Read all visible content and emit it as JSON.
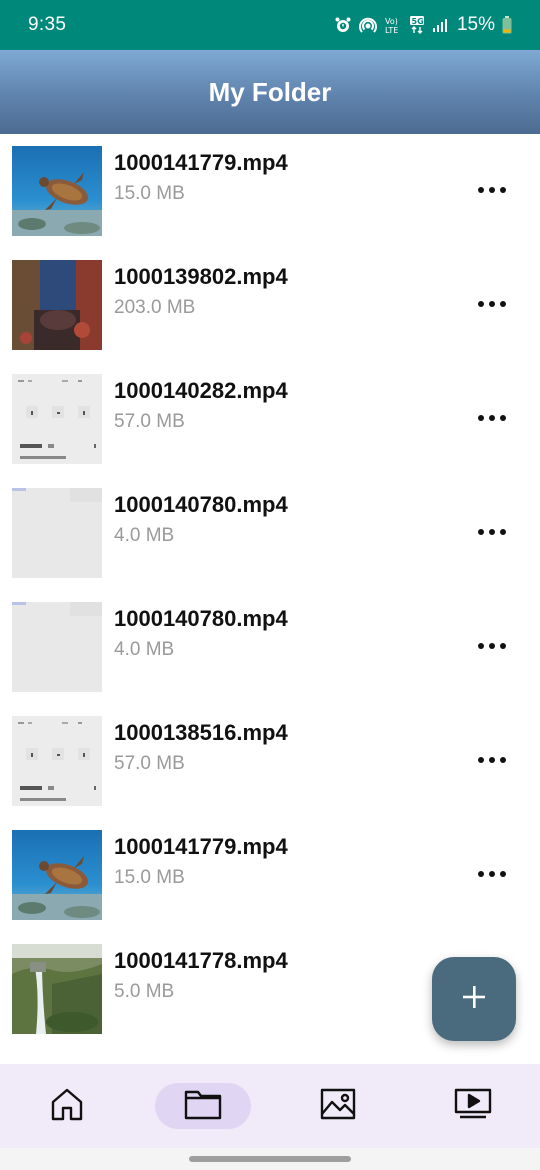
{
  "status_bar": {
    "time": "9:35",
    "battery": "15%",
    "icons": [
      "alarm-icon",
      "hotspot-icon",
      "volte-icon",
      "5g-icon",
      "signal-icon",
      "battery-icon"
    ]
  },
  "app_bar": {
    "title": "My Folder"
  },
  "files": [
    {
      "name": "1000141779.mp4",
      "size": "15.0 MB",
      "thumbnail": "turtle"
    },
    {
      "name": "1000139802.mp4",
      "size": "203.0 MB",
      "thumbnail": "person"
    },
    {
      "name": "1000140282.mp4",
      "size": "57.0 MB",
      "thumbnail": "screen"
    },
    {
      "name": "1000140780.mp4",
      "size": "4.0 MB",
      "thumbnail": "blank"
    },
    {
      "name": "1000140780.mp4",
      "size": "4.0 MB",
      "thumbnail": "blank"
    },
    {
      "name": "1000138516.mp4",
      "size": "57.0 MB",
      "thumbnail": "screen"
    },
    {
      "name": "1000141779.mp4",
      "size": "15.0 MB",
      "thumbnail": "turtle"
    },
    {
      "name": "1000141778.mp4",
      "size": "5.0 MB",
      "thumbnail": "waterfall"
    }
  ],
  "fab": {
    "icon": "plus-icon"
  },
  "bottom_nav": {
    "items": [
      {
        "icon": "home-icon",
        "active": false
      },
      {
        "icon": "folder-icon",
        "active": true
      },
      {
        "icon": "image-icon",
        "active": false
      },
      {
        "icon": "video-icon",
        "active": false
      }
    ]
  },
  "colors": {
    "status_bar": "#00897b",
    "app_bar_top": "#7fa9d4",
    "app_bar_bottom": "#4c6b92",
    "fab": "#4a6a7e",
    "nav_background": "#f0eaf9",
    "nav_active": "#e0d6f3",
    "file_size_text": "#9a9a9a"
  }
}
